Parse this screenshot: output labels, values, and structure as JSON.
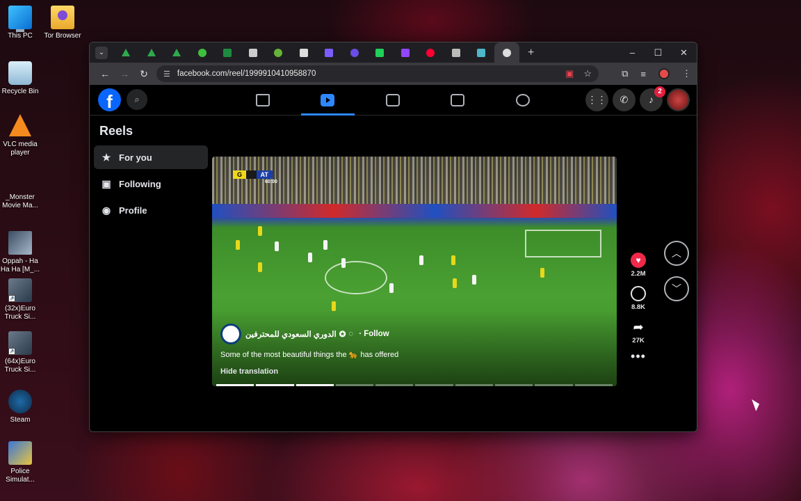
{
  "desktop": {
    "icons": [
      {
        "label": "This PC",
        "icon": "computer-icon"
      },
      {
        "label": "Tor Browser",
        "icon": "tor-browser-icon"
      },
      {
        "label": "Recycle Bin",
        "icon": "recycle-bin-icon"
      },
      {
        "label": "VLC media player",
        "icon": "vlc-icon"
      },
      {
        "label": "_Monster Movie Ma...",
        "icon": "file-icon"
      },
      {
        "label": "Oppah - Ha Ha Ha [M_...",
        "icon": "video-thumbnail-icon"
      },
      {
        "label": "(32x)Euro Truck Si...",
        "icon": "truck-game-icon"
      },
      {
        "label": "(64x)Euro Truck Si...",
        "icon": "truck-game-icon"
      },
      {
        "label": "Steam",
        "icon": "steam-icon"
      },
      {
        "label": "Police Simulat...",
        "icon": "police-game-icon"
      }
    ]
  },
  "browser": {
    "url": "facebook.com/reel/1999910410958870",
    "tab_favicons": [
      "#2fa94e",
      "#2fa94e",
      "#2fa94e",
      "#3fbf3f",
      "#1f8a3f",
      "#cccccc",
      "#67b33a",
      "#dddddd",
      "#7b5cff",
      "#6b4de6",
      "#1fd15a",
      "#9146ff",
      "#ff0033",
      "#bbbbbb",
      "#4db8c8",
      "#dddddd"
    ],
    "window_controls": {
      "minimize": "–",
      "maximize": "☐",
      "close": "✕"
    }
  },
  "facebook": {
    "nav": [
      {
        "name": "home",
        "active": false
      },
      {
        "name": "reels",
        "active": true
      },
      {
        "name": "dashboard",
        "active": false
      },
      {
        "name": "marketplace",
        "active": false
      },
      {
        "name": "groups",
        "active": false
      }
    ],
    "notifications_count": "2",
    "sidebar": {
      "title": "Reels",
      "items": [
        {
          "label": "For you",
          "icon": "star-icon",
          "active": true
        },
        {
          "label": "Following",
          "icon": "following-icon",
          "active": false
        },
        {
          "label": "Profile",
          "icon": "profile-icon",
          "active": false
        }
      ]
    },
    "reel": {
      "scoreboard": {
        "team1": "G",
        "team2": "AT",
        "clock": "60:00"
      },
      "channel_name": "الدوري السعودي للمحترفين",
      "follow_label": "· Follow",
      "caption_pre": "Some of the most beautiful things the ",
      "caption_emoji": "🐆",
      "caption_post": " has offered",
      "hide_translation": "Hide translation",
      "progress_segments": 10,
      "progress_done": 3
    },
    "actions": {
      "likes": "2.2M",
      "comments": "8.8K",
      "shares": "27K"
    }
  }
}
